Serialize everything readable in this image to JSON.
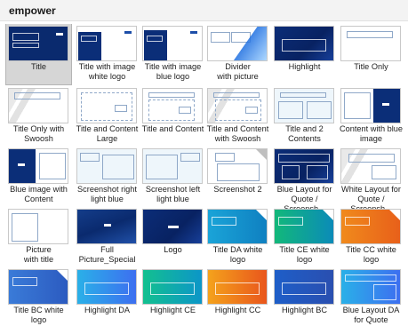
{
  "header": {
    "title": "empower"
  },
  "layouts": [
    {
      "label": "Title",
      "selected": true,
      "style": "title"
    },
    {
      "label": "Title with image\nwhite logo",
      "style": "img-white"
    },
    {
      "label": "Title with image\nblue logo",
      "style": "img-blue"
    },
    {
      "label": "Divider\nwith picture",
      "style": "divider"
    },
    {
      "label": "Highlight",
      "style": "highlight"
    },
    {
      "label": "Title Only",
      "style": "title-only"
    },
    {
      "label": "Title Only with\nSwoosh",
      "style": "swoosh"
    },
    {
      "label": "Title and Content\nLarge",
      "style": "content-large"
    },
    {
      "label": "Title and Content",
      "style": "content"
    },
    {
      "label": "Title and Content\nwith Swoosh",
      "style": "content-swoosh"
    },
    {
      "label": "Title and 2\nContents",
      "style": "two"
    },
    {
      "label": "Content with blue\nimage",
      "style": "content-blue"
    },
    {
      "label": "Blue image with\nContent",
      "style": "blue-content"
    },
    {
      "label": "Screenshot right\nlight blue",
      "style": "ss-right"
    },
    {
      "label": "Screenshot left\nlight blue",
      "style": "ss-left"
    },
    {
      "label": "Screenshot 2",
      "style": "ss2"
    },
    {
      "label": "Blue Layout for\nQuote / Screensh...",
      "style": "blue-quote"
    },
    {
      "label": "White Layout for\nQuote / Screensh...",
      "style": "white-quote"
    },
    {
      "label": "Picture\nwith title",
      "style": "picture"
    },
    {
      "label": "Full\nPicture_Special",
      "style": "full-picture"
    },
    {
      "label": "Logo",
      "style": "logo"
    },
    {
      "label": "Title DA white\nlogo",
      "style": "da"
    },
    {
      "label": "Title CE white\nlogo",
      "style": "ce"
    },
    {
      "label": "Title CC white\nlogo",
      "style": "cc"
    },
    {
      "label": "Title BC white\nlogo",
      "style": "bc"
    },
    {
      "label": "Highlight DA",
      "style": "hl-da"
    },
    {
      "label": "Highlight CE",
      "style": "hl-ce"
    },
    {
      "label": "Highlight CC",
      "style": "hl-cc"
    },
    {
      "label": "Highlight BC",
      "style": "hl-bc"
    },
    {
      "label": "Blue Layout DA\nfor Quote",
      "style": "blue-da"
    }
  ]
}
